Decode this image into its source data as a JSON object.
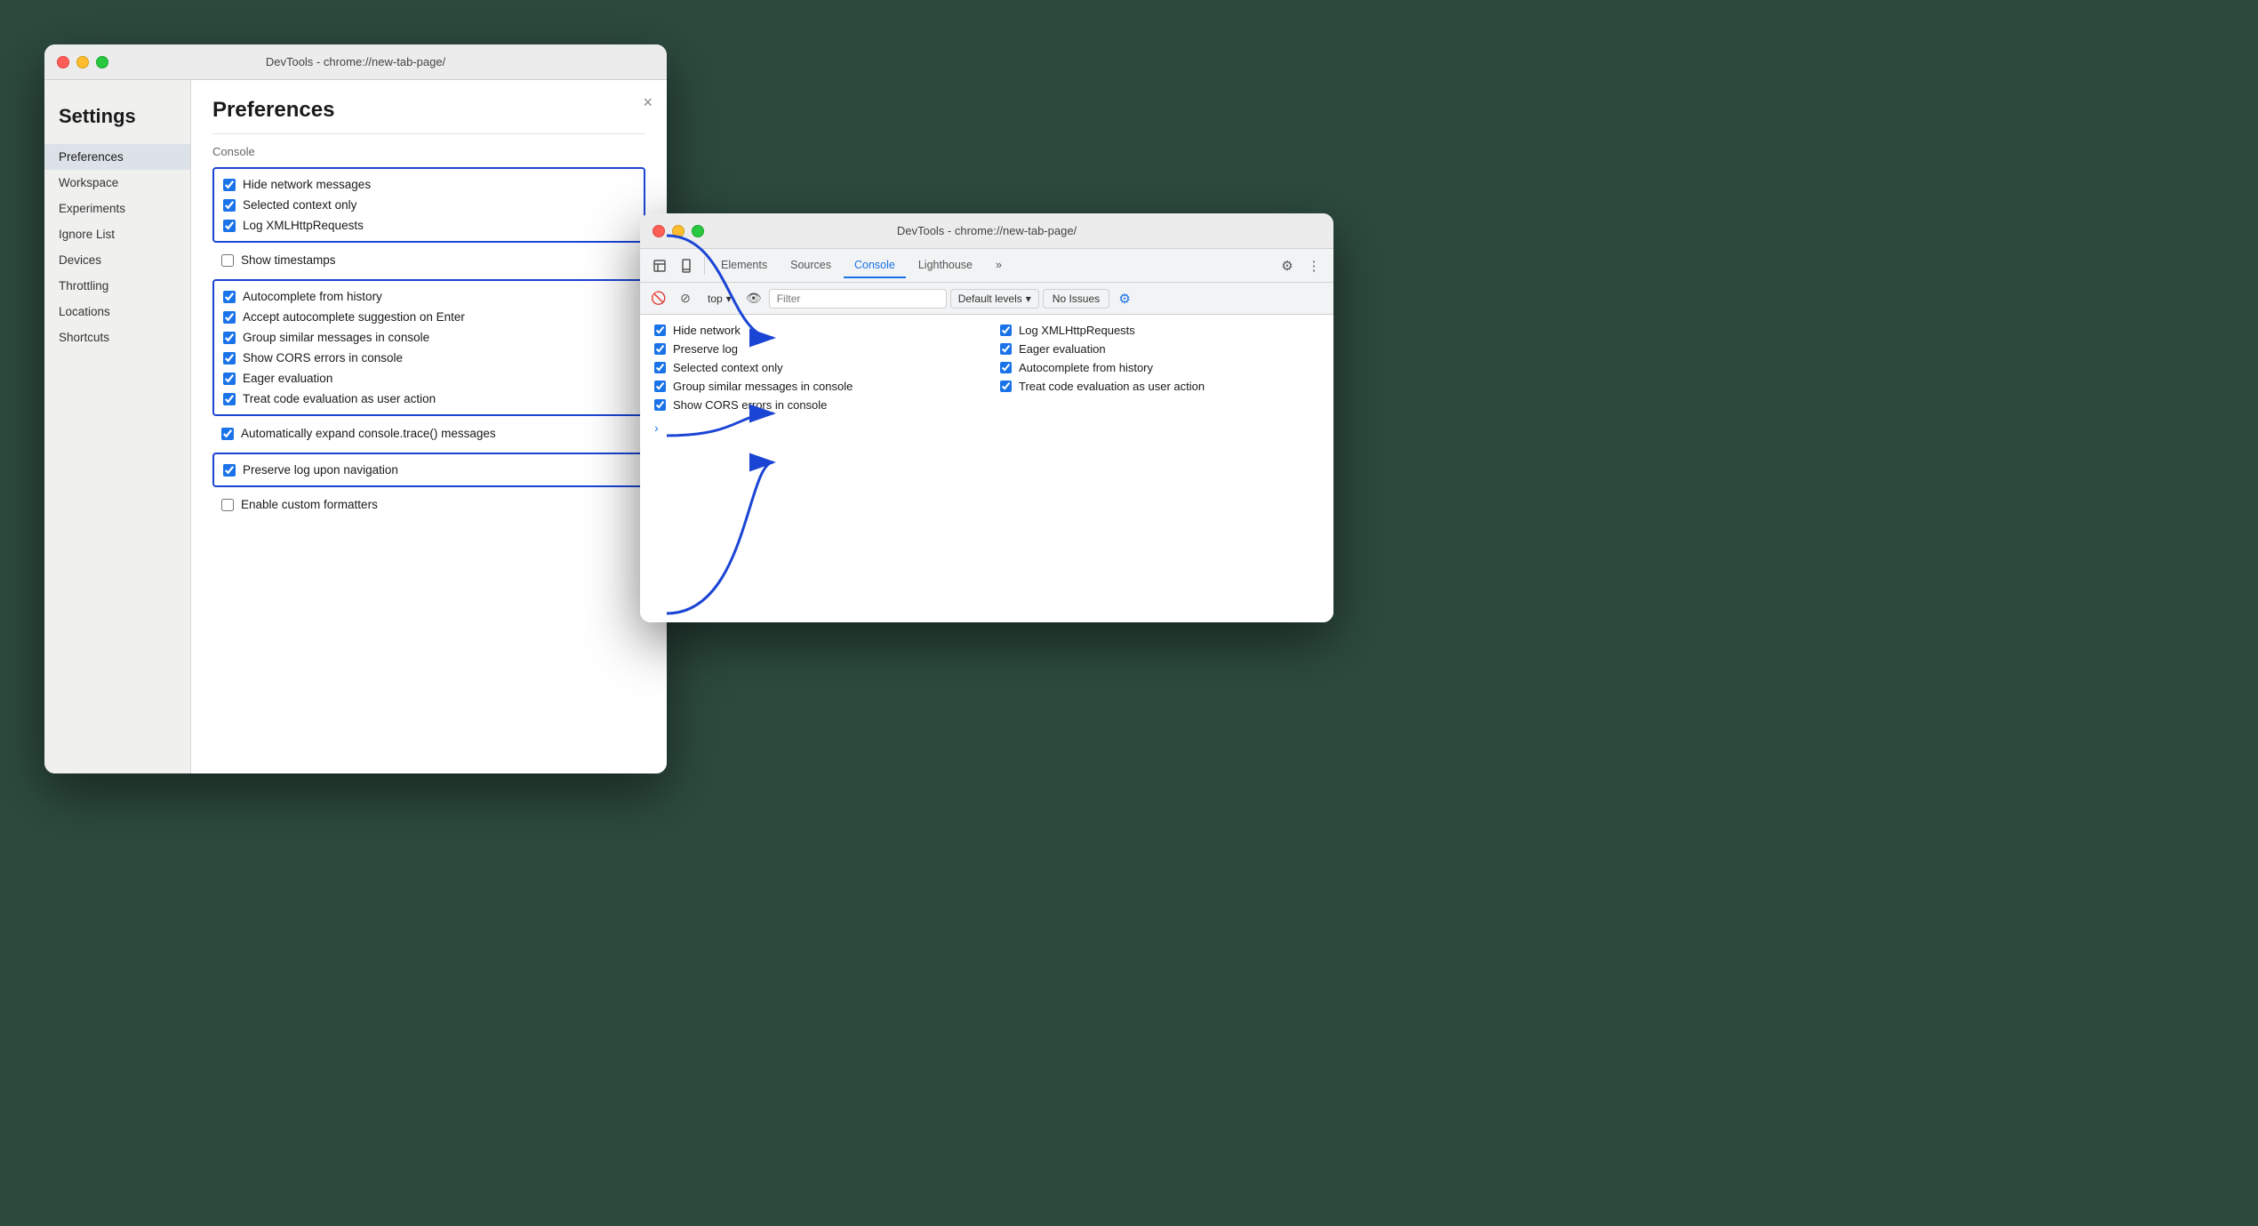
{
  "body_bg": "#2d5040",
  "settings_window": {
    "title": "DevTools - chrome://new-tab-page/",
    "heading": "Settings",
    "close_btn": "×",
    "sidebar": {
      "items": [
        {
          "label": "Preferences",
          "active": true
        },
        {
          "label": "Workspace",
          "active": false
        },
        {
          "label": "Experiments",
          "active": false
        },
        {
          "label": "Ignore List",
          "active": false
        },
        {
          "label": "Devices",
          "active": false
        },
        {
          "label": "Throttling",
          "active": false
        },
        {
          "label": "Locations",
          "active": false
        },
        {
          "label": "Shortcuts",
          "active": false
        }
      ]
    },
    "main": {
      "title": "Preferences",
      "section_label": "Console",
      "group1": {
        "items": [
          {
            "label": "Hide network messages",
            "checked": true
          },
          {
            "label": "Selected context only",
            "checked": true
          },
          {
            "label": "Log XMLHttpRequests",
            "checked": true
          }
        ]
      },
      "standalone": [
        {
          "label": "Show timestamps",
          "checked": false
        }
      ],
      "group2": {
        "items": [
          {
            "label": "Autocomplete from history",
            "checked": true
          },
          {
            "label": "Accept autocomplete suggestion on Enter",
            "checked": true
          },
          {
            "label": "Group similar messages in console",
            "checked": true
          },
          {
            "label": "Show CORS errors in console",
            "checked": true
          },
          {
            "label": "Eager evaluation",
            "checked": true
          },
          {
            "label": "Treat code evaluation as user action",
            "checked": true
          }
        ]
      },
      "standalone2": [
        {
          "label": "Automatically expand console.trace() messages",
          "checked": true
        }
      ],
      "group3": {
        "items": [
          {
            "label": "Preserve log upon navigation",
            "checked": true
          }
        ]
      },
      "standalone3": [
        {
          "label": "Enable custom formatters",
          "checked": false
        }
      ]
    }
  },
  "devtools_window": {
    "title": "DevTools - chrome://new-tab-page/",
    "tabs": [
      {
        "label": "",
        "icon": "⬜",
        "type": "icon"
      },
      {
        "label": "",
        "icon": "⬛",
        "type": "icon"
      },
      {
        "label": "Elements"
      },
      {
        "label": "Sources"
      },
      {
        "label": "Console",
        "active": true
      },
      {
        "label": "Lighthouse"
      },
      {
        "label": "»"
      }
    ],
    "toolbar": {
      "filter_placeholder": "Filter",
      "top_label": "top",
      "levels_label": "Default levels",
      "issues_label": "No Issues"
    },
    "console": {
      "col1": [
        {
          "label": "Hide network",
          "checked": true
        },
        {
          "label": "Preserve log",
          "checked": true
        },
        {
          "label": "Selected context only",
          "checked": true
        },
        {
          "label": "Group similar messages in console",
          "checked": true
        },
        {
          "label": "Show CORS errors in console",
          "checked": true
        }
      ],
      "col2": [
        {
          "label": "Log XMLHttpRequests",
          "checked": true
        },
        {
          "label": "Eager evaluation",
          "checked": true
        },
        {
          "label": "Autocomplete from history",
          "checked": true
        },
        {
          "label": "Treat code evaluation as user action",
          "checked": true
        }
      ]
    }
  }
}
